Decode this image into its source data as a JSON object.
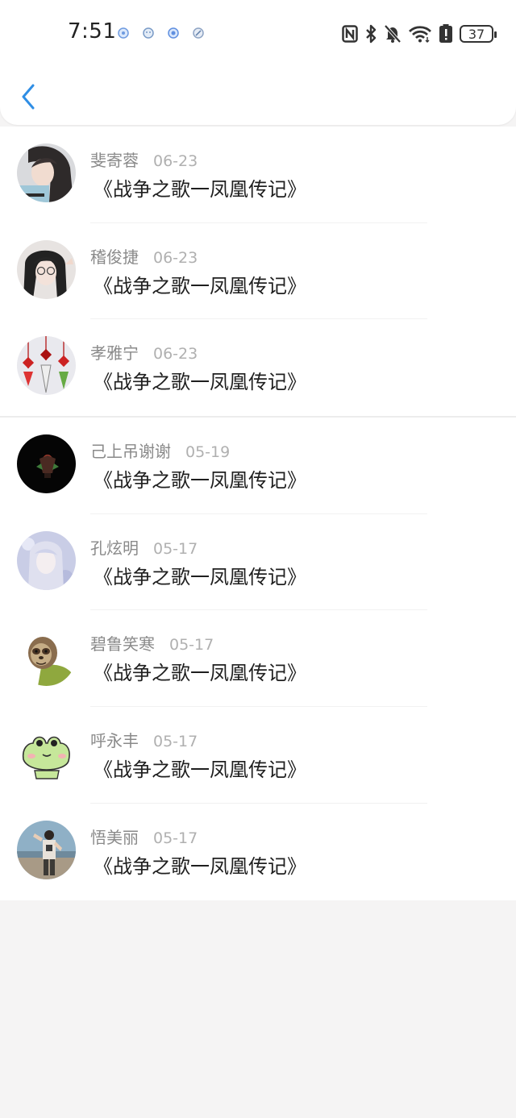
{
  "status_bar": {
    "time": "7:51",
    "battery": "37"
  },
  "items": [
    {
      "name": "斐寄蓉",
      "date": "06-23",
      "title": "《战争之歌一凤凰传记》",
      "avatar": "woman-selfie-avatar"
    },
    {
      "name": "稽俊捷",
      "date": "06-23",
      "title": "《战争之歌一凤凰传记》",
      "avatar": "girl-glasses-avatar"
    },
    {
      "name": "孝雅宁",
      "date": "06-23",
      "title": "《战争之歌一凤凰传记》",
      "avatar": "chinese-knots-avatar"
    },
    {
      "name": "己上吊谢谢",
      "date": "05-19",
      "title": "《战争之歌一凤凰传记》",
      "avatar": "dark-figure-avatar"
    },
    {
      "name": "孔炫明",
      "date": "05-17",
      "title": "《战争之歌一凤凰传记》",
      "avatar": "pale-girl-avatar"
    },
    {
      "name": "碧鲁笑寒",
      "date": "05-17",
      "title": "《战争之歌一凤凰传记》",
      "avatar": "sloth-avatar"
    },
    {
      "name": "呼永丰",
      "date": "05-17",
      "title": "《战争之歌一凤凰传记》",
      "avatar": "frog-avatar"
    },
    {
      "name": "悟美丽",
      "date": "05-17",
      "title": "《战争之歌一凤凰传记》",
      "avatar": "person-outdoor-avatar"
    }
  ],
  "colors": {
    "accent": "#2f8ee5",
    "background": "#f5f4f4",
    "name_text": "#8a8a8a",
    "date_text": "#b0b0b0",
    "title_text": "#1f1f1f"
  }
}
